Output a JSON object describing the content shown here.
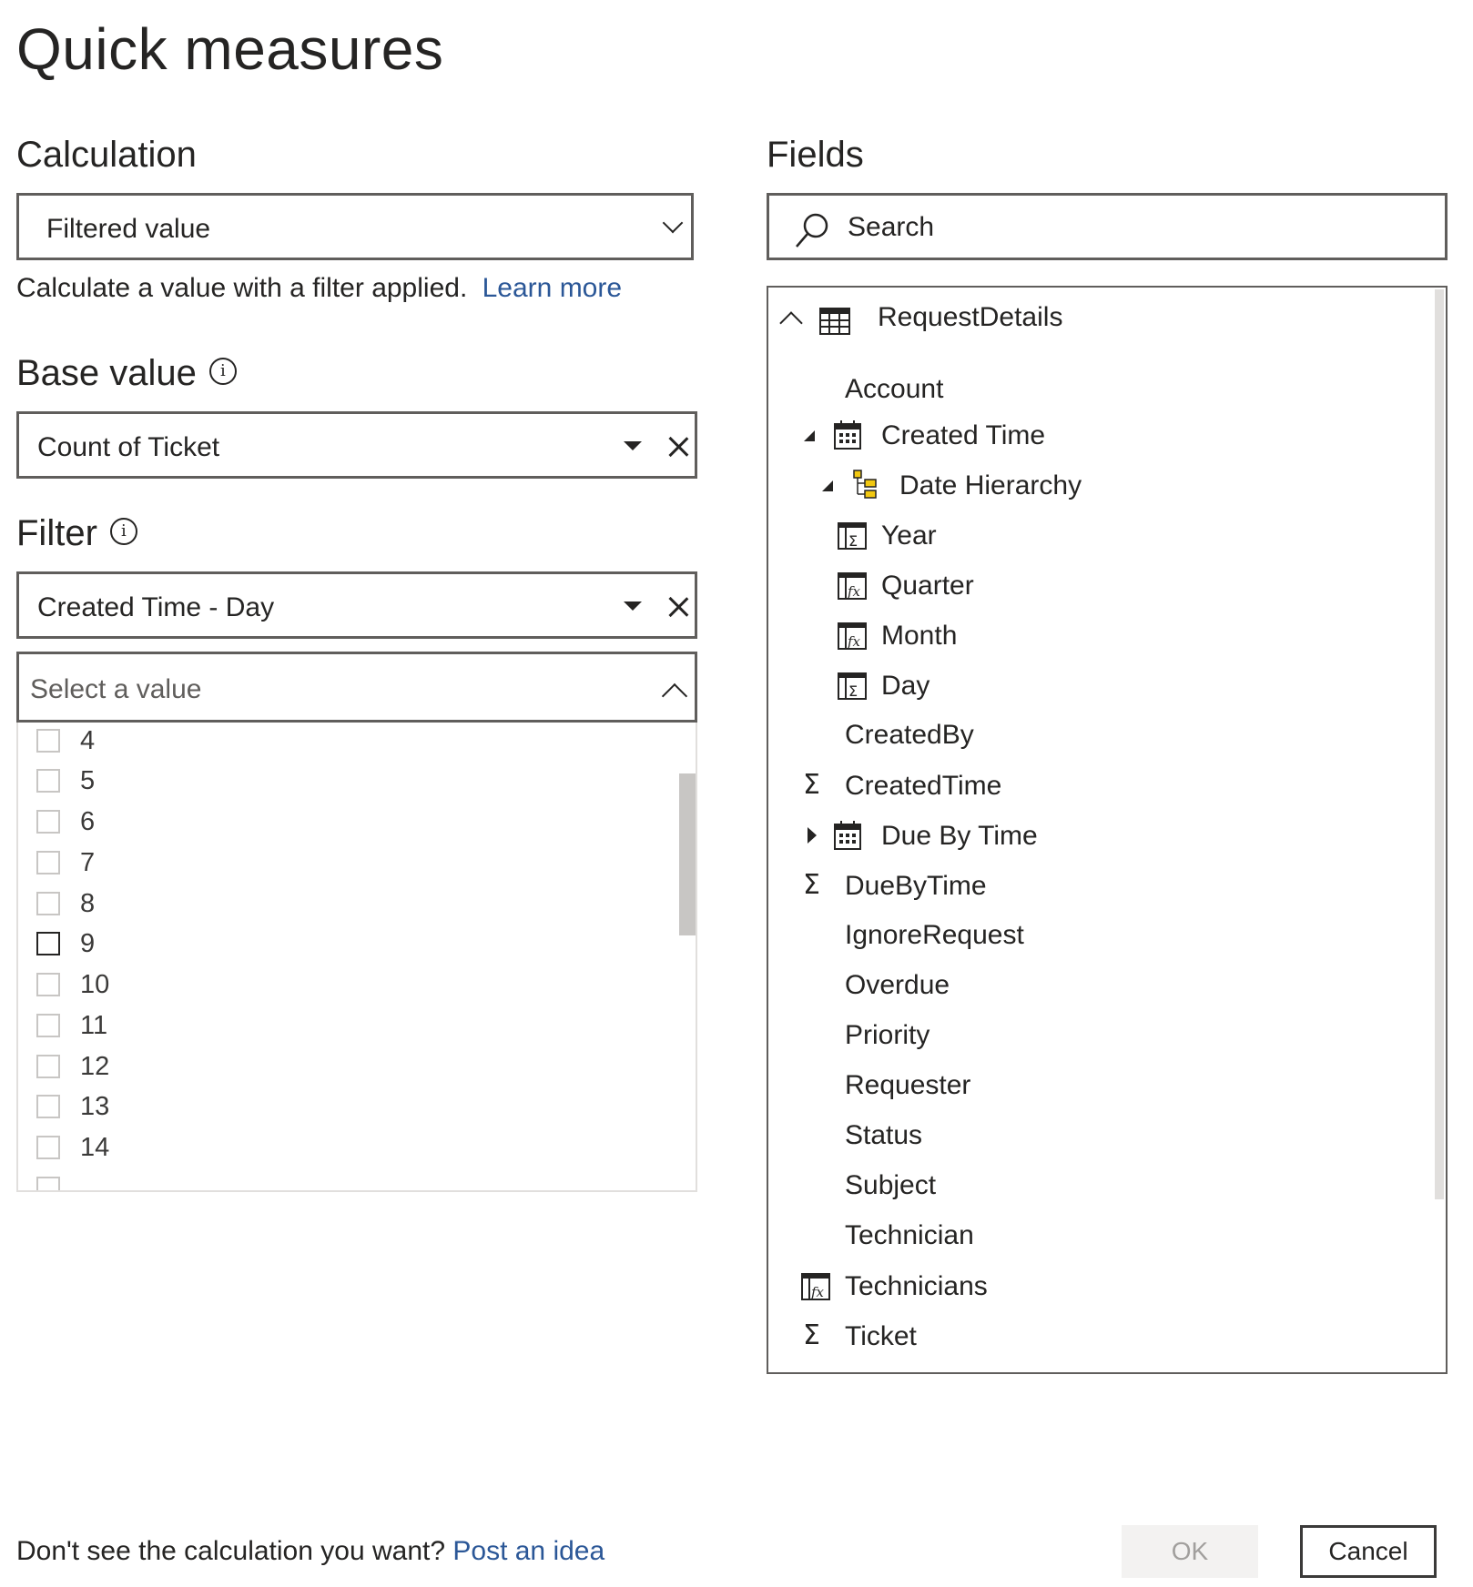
{
  "page_title": "Quick measures",
  "calculation": {
    "label": "Calculation",
    "selected": "Filtered value",
    "description": "Calculate a value with a filter applied.",
    "learn_more": "Learn more"
  },
  "base_value": {
    "label": "Base value",
    "value": "Count of Ticket"
  },
  "filter": {
    "label": "Filter",
    "field": "Created Time - Day",
    "select_placeholder": "Select a value",
    "values": [
      "4",
      "5",
      "6",
      "7",
      "8",
      "9",
      "10",
      "11",
      "12",
      "13",
      "14"
    ]
  },
  "fields": {
    "label": "Fields",
    "search_placeholder": "Search",
    "table_name": "RequestDetails",
    "items": {
      "account": "Account",
      "created_time": "Created Time",
      "date_hierarchy": "Date Hierarchy",
      "year": "Year",
      "quarter": "Quarter",
      "month": "Month",
      "day": "Day",
      "created_by": "CreatedBy",
      "created_time_num": "CreatedTime",
      "due_by_time": "Due By Time",
      "due_by_time_num": "DueByTime",
      "ignore_request": "IgnoreRequest",
      "overdue": "Overdue",
      "priority": "Priority",
      "requester": "Requester",
      "status": "Status",
      "subject": "Subject",
      "technician": "Technician",
      "technicians": "Technicians",
      "ticket": "Ticket"
    }
  },
  "footer": {
    "prompt": "Don't see the calculation you want?",
    "post_idea": "Post an idea",
    "ok_label": "OK",
    "cancel_label": "Cancel"
  },
  "colors": {
    "link": "#2b5797",
    "border": "#605e5c",
    "disabled_button_bg": "#f3f2f1",
    "hierarchy_accent": "#f2c811"
  }
}
